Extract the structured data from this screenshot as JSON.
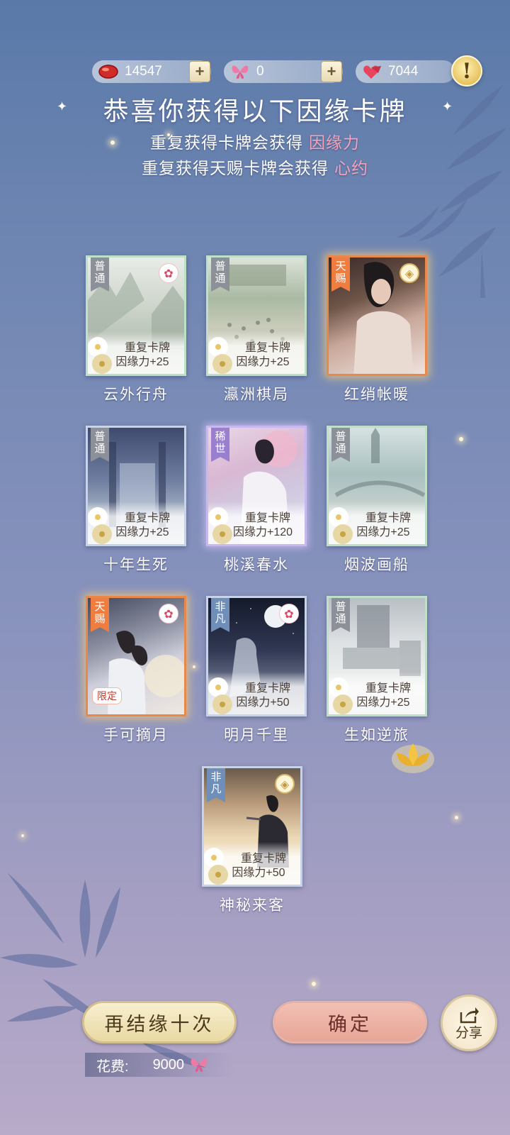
{
  "currency": [
    {
      "icon": "red-gem-icon",
      "value": "14547",
      "has_plus": true
    },
    {
      "icon": "butterfly-icon",
      "value": "0",
      "has_plus": true
    },
    {
      "icon": "heart-gem-icon",
      "value": "7044",
      "has_plus": false
    }
  ],
  "headline": "恭喜你获得以下因缘卡牌",
  "sub1": {
    "text": "重复获得卡牌会获得",
    "highlight": "因缘力"
  },
  "sub2": {
    "text": "重复获得天赐卡牌会获得",
    "highlight": "心约"
  },
  "cards": [
    {
      "name": "云外行舟",
      "rarity": "普通",
      "dup_line1": "重复卡牌",
      "dup_line2": "因缘力+25"
    },
    {
      "name": "瀛洲棋局",
      "rarity": "普通",
      "dup_line1": "重复卡牌",
      "dup_line2": "因缘力+25"
    },
    {
      "name": "红绡帐暖",
      "rarity": "天赐"
    },
    {
      "name": "十年生死",
      "rarity": "普通",
      "dup_line1": "重复卡牌",
      "dup_line2": "因缘力+25"
    },
    {
      "name": "桃溪春水",
      "rarity": "稀世",
      "dup_line1": "重复卡牌",
      "dup_line2": "因缘力+120"
    },
    {
      "name": "烟波画船",
      "rarity": "普通",
      "dup_line1": "重复卡牌",
      "dup_line2": "因缘力+25"
    },
    {
      "name": "手可摘月",
      "rarity": "天赐",
      "limited": "限定"
    },
    {
      "name": "明月千里",
      "rarity": "非凡",
      "dup_line1": "重复卡牌",
      "dup_line2": "因缘力+50"
    },
    {
      "name": "生如逆旅",
      "rarity": "普通",
      "dup_line1": "重复卡牌",
      "dup_line2": "因缘力+25"
    },
    {
      "name": "神秘来客",
      "rarity": "非凡",
      "dup_line1": "重复卡牌",
      "dup_line2": "因缘力+50"
    }
  ],
  "buttons": {
    "again": "再结缘十次",
    "confirm": "确定",
    "share": "分享"
  },
  "cost": {
    "label": "花费:",
    "amount": "9000"
  },
  "colors": {
    "highlight": "#f5a3b8",
    "common_tag": "#8c9098",
    "uncommon_tag": "#6f8eb8",
    "rare_tag": "#9a7fce",
    "gift_tag": "#ef7d3f"
  }
}
